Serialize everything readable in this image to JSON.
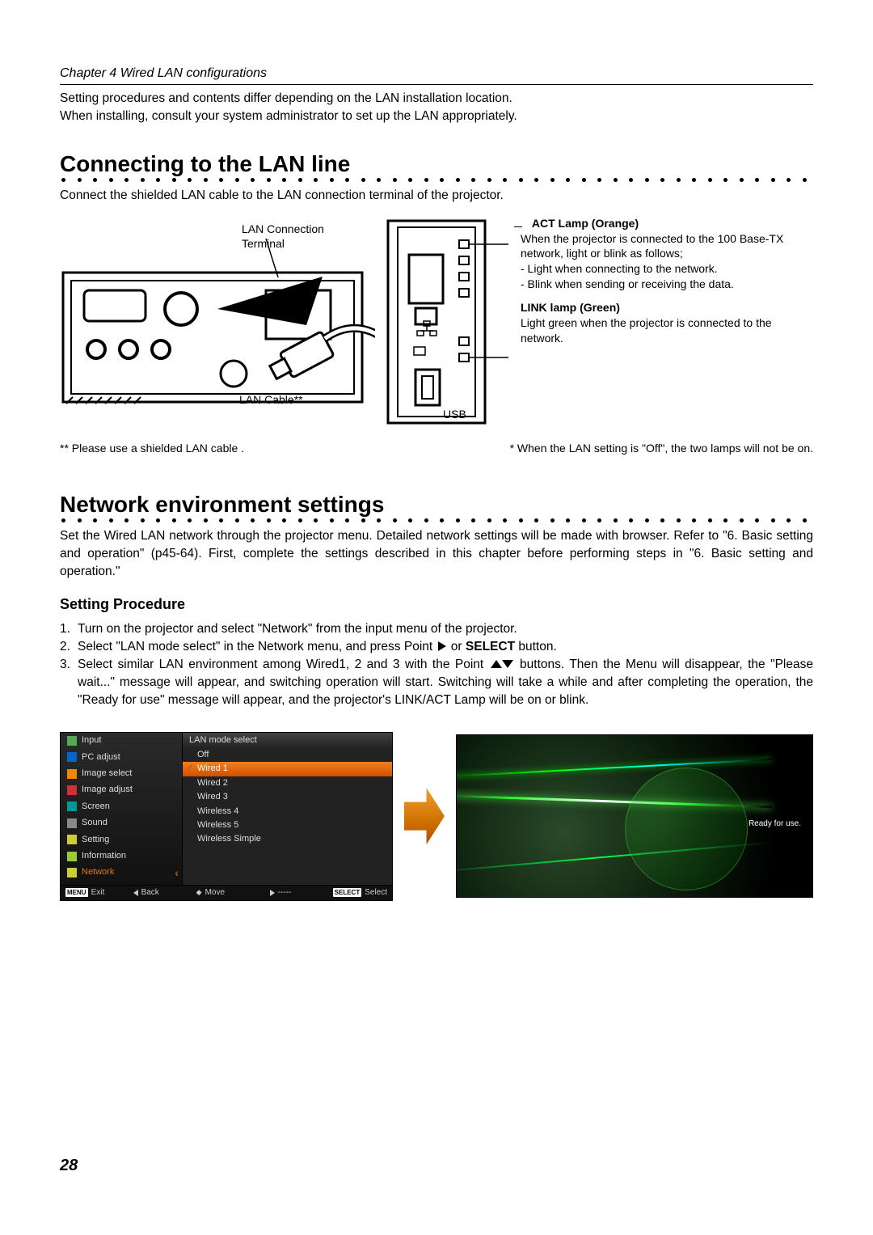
{
  "chapter_header": "Chapter 4 Wired LAN configurations",
  "intro_line1": "Setting procedures and contents differ depending on the LAN installation location.",
  "intro_line2": "When installing, consult your system administrator to set up the LAN appropriately.",
  "section1_heading": "Connecting to the LAN line",
  "section1_body": "Connect the shielded LAN cable to the LAN connection terminal of the projector.",
  "diagram_labels": {
    "lan_terminal_l1": "LAN Connection",
    "lan_terminal_l2": "Terminal",
    "lan_cable": "LAN Cable**",
    "usb": "USB"
  },
  "act_lamp": {
    "title": "ACT Lamp (Orange)",
    "desc": "When the projector is connected to the 100 Base-TX network, light or blink as follows;",
    "bullet1": "- Light when connecting to the network.",
    "bullet2": "- Blink when sending or receiving the data."
  },
  "link_lamp": {
    "title": "LINK lamp (Green)",
    "desc": "Light green when the projector is connected to the network."
  },
  "footnote_left": "** Please use a shielded LAN cable .",
  "footnote_right": "* When the LAN setting is \"Off\", the two lamps will not be on.",
  "section2_heading": "Network environment settings",
  "section2_body": "Set the Wired LAN network through the projector menu. Detailed network settings will be made with browser. Refer to \"6. Basic setting and operation\" (p45-64). First, complete the settings described in this chapter before performing steps in \"6. Basic setting and operation.\"",
  "setting_procedure_heading": "Setting Procedure",
  "steps": {
    "s1": {
      "num": "1.",
      "text": "Turn on the projector and select \"Network\" from the input menu of the projector."
    },
    "s2": {
      "num": "2.",
      "pre": "Select \"LAN mode select\" in the Network menu, and press Point ",
      "mid": " or ",
      "select_bold": "SELECT",
      "post": " button."
    },
    "s3": {
      "num": "3.",
      "pre": "Select similar LAN environment among Wired1, 2 and 3 with the Point ",
      "post": " buttons. Then the Menu will disappear, the \"Please wait...\" message will appear, and switching operation will start. Switching will take a while and after completing the operation, the \"Ready for use\" message will appear, and the projector's LINK/ACT Lamp will be on or blink."
    }
  },
  "menu": {
    "left_items": [
      "Input",
      "PC adjust",
      "Image select",
      "Image adjust",
      "Screen",
      "Sound",
      "Setting",
      "Information",
      "Network"
    ],
    "right_header": "LAN mode select",
    "right_items": [
      "Off",
      "Wired 1",
      "Wired 2",
      "Wired 3",
      "Wireless 4",
      "Wireless 5",
      "Wireless Simple"
    ],
    "footer": {
      "exit_badge": "MENU",
      "exit": "Exit",
      "back": "Back",
      "move": "Move",
      "dashes": "-----",
      "select_badge": "SELECT",
      "select": "Select"
    }
  },
  "network_ready": "Ready for use.",
  "page_number": "28"
}
